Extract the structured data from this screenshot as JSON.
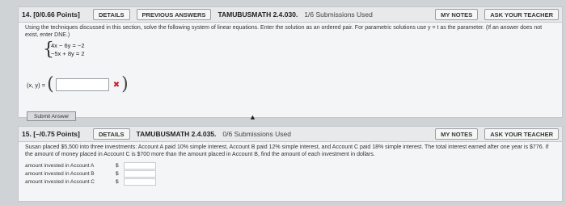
{
  "q14": {
    "number": "14.",
    "points": "[0/0.66 Points]",
    "details": "DETAILS",
    "previous": "PREVIOUS ANSWERS",
    "code": "TAMUBUSMATH 2.4.030.",
    "submissions": "1/6 Submissions Used",
    "my_notes": "MY NOTES",
    "ask_teacher": "ASK YOUR TEACHER",
    "instructions": "Using the techniques discussed in this section, solve the following system of linear equations. Enter the solution as an ordered pair. For parametric solutions use y = t as the parameter. (If an answer does not exist, enter DNE.)",
    "eq1": "4x − 6y = −2",
    "eq2": "−5x + 8y = 2",
    "answer_label": "(x, y) =",
    "answer_value": "",
    "wrong_mark": "✖",
    "submit": "Submit Answer"
  },
  "q15": {
    "number": "15.",
    "points": "[–/0.75 Points]",
    "details": "DETAILS",
    "code": "TAMUBUSMATH 2.4.035.",
    "submissions": "0/6 Submissions Used",
    "my_notes": "MY NOTES",
    "ask_teacher": "ASK YOUR TEACHER",
    "problem": "Susan placed $5,500 into three investments: Account A paid 10% simple interest, Account B paid 12% simple interest, and Account C paid 18% simple interest. The total interest earned after one year is $776. If the amount of money placed in Account C is $700 more than the amount placed in Account B, find the amount of each investment in dollars.",
    "rows": [
      {
        "label": "amount invested in Account A",
        "currency": "$"
      },
      {
        "label": "amount invested in Account B",
        "currency": "$"
      },
      {
        "label": "amount invested in Account C",
        "currency": "$"
      }
    ]
  }
}
